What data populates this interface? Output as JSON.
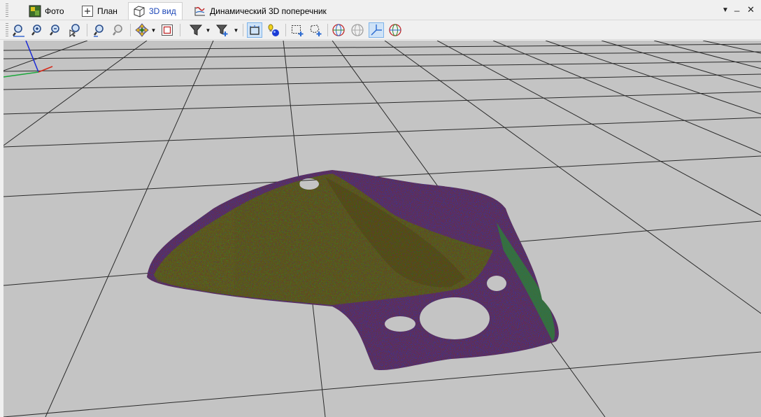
{
  "tabs": [
    {
      "label": "Фото",
      "icon": "photo-icon",
      "active": false
    },
    {
      "label": "План",
      "icon": "plan-icon",
      "active": false
    },
    {
      "label": "3D вид",
      "icon": "cube-3d-icon",
      "active": true
    },
    {
      "label": "Динамический 3D поперечник",
      "icon": "cross-section-icon",
      "active": false
    }
  ],
  "window_controls": {
    "menu": "▼",
    "minimize": "_",
    "close": "✕"
  },
  "toolbar": [
    {
      "name": "zoom-extents-button",
      "icon": "zoom-extents-icon"
    },
    {
      "name": "zoom-in-button",
      "icon": "zoom-in-icon"
    },
    {
      "name": "zoom-out-button",
      "icon": "zoom-out-icon"
    },
    {
      "name": "zoom-select-button",
      "icon": "zoom-select-icon"
    },
    {
      "name": "zoom-previous-button",
      "icon": "zoom-previous-icon"
    },
    {
      "name": "zoom-next-button",
      "icon": "zoom-next-icon"
    },
    {
      "name": "pan-navigate-button",
      "icon": "navigate-icon"
    },
    {
      "name": "frame-button",
      "icon": "frame-icon"
    },
    {
      "name": "filter-button",
      "icon": "filter-icon"
    },
    {
      "name": "filter-add-button",
      "icon": "filter-add-icon"
    },
    {
      "name": "bounding-box-button",
      "icon": "bounding-box-icon",
      "pressed": true
    },
    {
      "name": "light-button",
      "icon": "light-bulb-icon"
    },
    {
      "name": "rect-select-button",
      "icon": "rect-select-icon"
    },
    {
      "name": "lasso-select-button",
      "icon": "lasso-select-icon"
    },
    {
      "name": "globe-view-button",
      "icon": "globe-icon"
    },
    {
      "name": "sphere-view-button",
      "icon": "sphere-icon"
    },
    {
      "name": "axes-button",
      "icon": "axes-icon",
      "pressed": true
    },
    {
      "name": "globe-color-button",
      "icon": "globe-color-icon"
    }
  ],
  "scene": {
    "background": "#c4c4c4",
    "grid_color": "#2a2a2a",
    "mesh_colors": [
      "#1f9a2a",
      "#1a3bd6",
      "#0a7a15",
      "#9a1a0a"
    ]
  }
}
